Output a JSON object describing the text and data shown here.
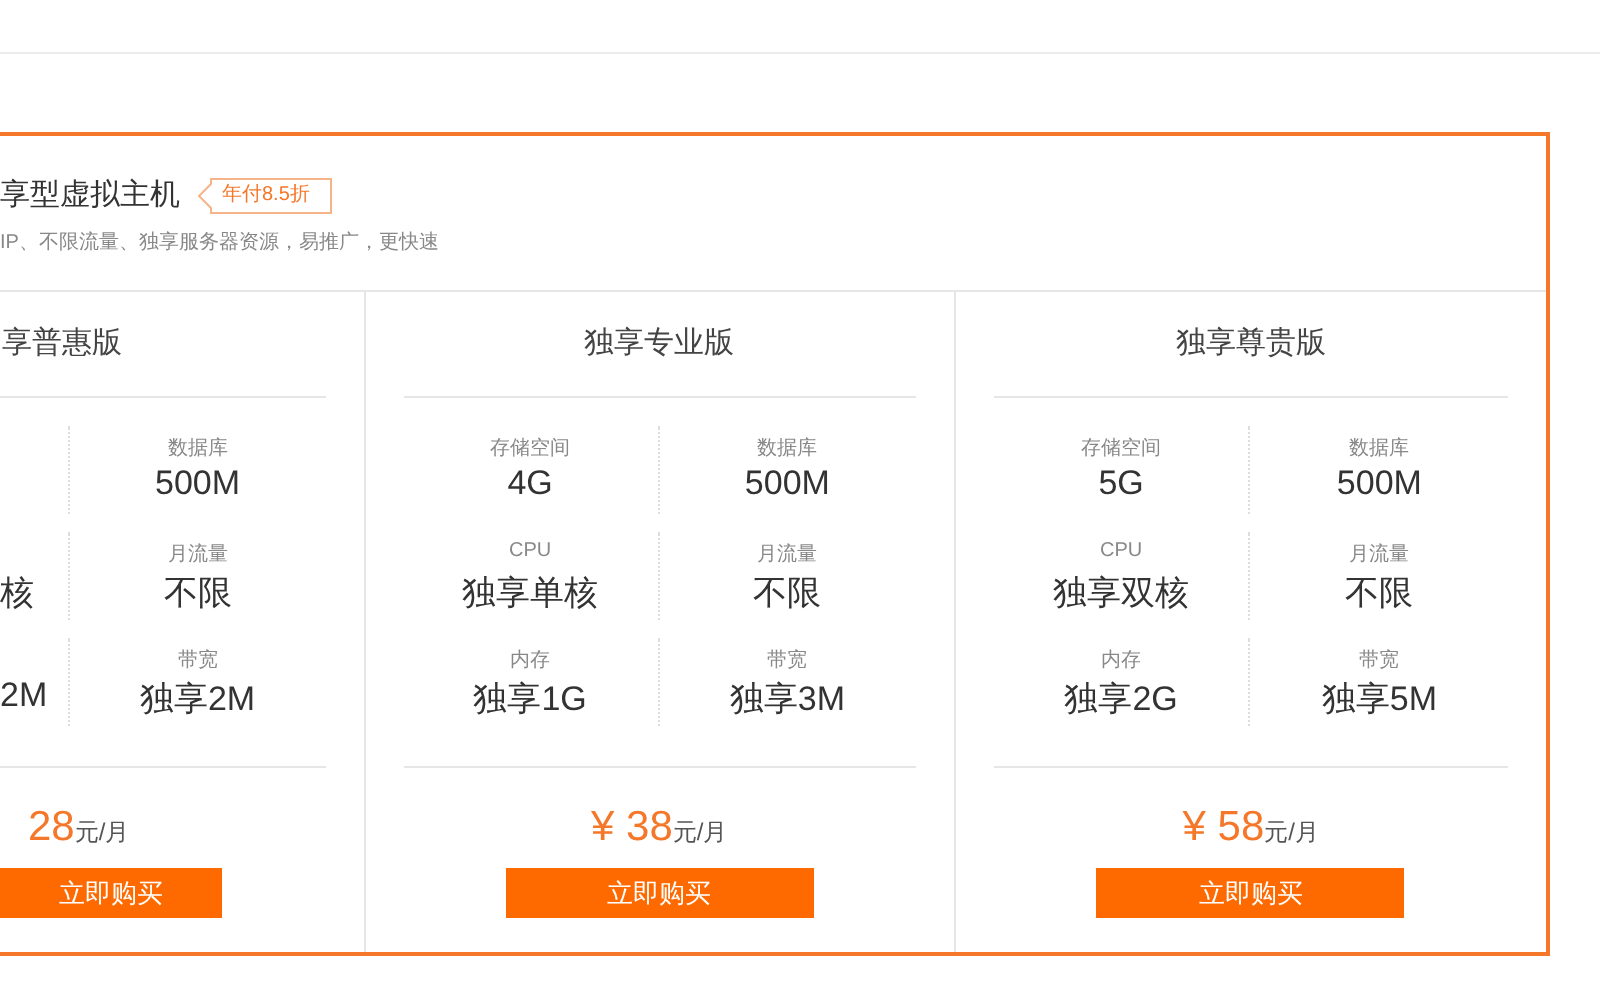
{
  "section": {
    "title": "享型虚拟主机",
    "badge": "年付8.5折",
    "description": "IP、不限流量、独享服务器资源，易推广，更快速"
  },
  "plans": [
    {
      "kind": "clipped",
      "title": "享普惠版",
      "specs": [
        {
          "right": {
            "label": "数据库",
            "value": "500M"
          }
        },
        {
          "left": {
            "value": "核"
          },
          "right": {
            "label": "月流量",
            "value": "不限"
          }
        },
        {
          "left": {
            "value": "2M"
          },
          "right": {
            "label": "带宽",
            "value": "独享2M"
          }
        }
      ],
      "price": "28",
      "unit": "元/月",
      "button": "立即购买"
    },
    {
      "kind": "full",
      "title": "独享专业版",
      "currency": "¥",
      "specs": [
        {
          "left": {
            "label": "存储空间",
            "value": "4G"
          },
          "right": {
            "label": "数据库",
            "value": "500M"
          }
        },
        {
          "left": {
            "label": "CPU",
            "value": "独享单核"
          },
          "right": {
            "label": "月流量",
            "value": "不限"
          }
        },
        {
          "left": {
            "label": "内存",
            "value": "独享1G"
          },
          "right": {
            "label": "带宽",
            "value": "独享3M"
          }
        }
      ],
      "price": "38",
      "unit": "元/月",
      "button": "立即购买"
    },
    {
      "kind": "full",
      "title": "独享尊贵版",
      "currency": "¥",
      "specs": [
        {
          "left": {
            "label": "存储空间",
            "value": "5G"
          },
          "right": {
            "label": "数据库",
            "value": "500M"
          }
        },
        {
          "left": {
            "label": "CPU",
            "value": "独享双核"
          },
          "right": {
            "label": "月流量",
            "value": "不限"
          }
        },
        {
          "left": {
            "label": "内存",
            "value": "独享2G"
          },
          "right": {
            "label": "带宽",
            "value": "独享5M"
          }
        }
      ],
      "price": "58",
      "unit": "元/月",
      "button": "立即购买"
    }
  ]
}
